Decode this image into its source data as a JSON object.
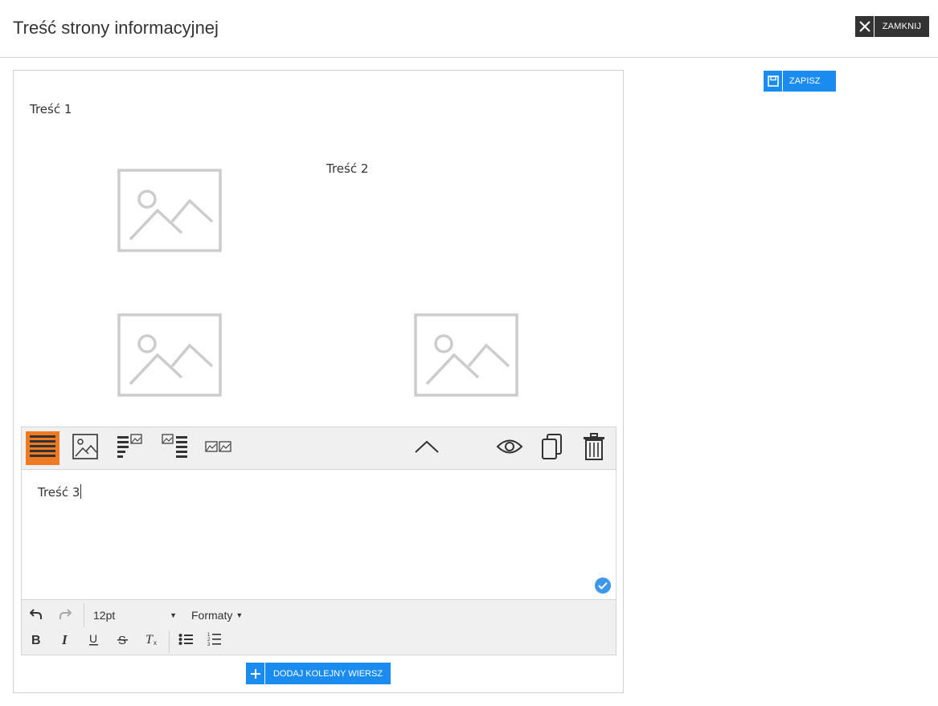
{
  "header": {
    "title": "Treść strony informacyjnej",
    "close_label": "ZAMKNIJ",
    "close_icon": "close-icon"
  },
  "actions": {
    "save_label": "ZAPISZ",
    "save_icon": "floppy-disk-icon"
  },
  "content": {
    "block1_text": "Treść 1",
    "block2_text": "Treść 2",
    "image_placeholder_icon": "image-placeholder-icon"
  },
  "block_toolbar": {
    "layouts": [
      "text-layout-icon",
      "image-layout-icon",
      "text-image-layout-icon",
      "image-text-layout-icon",
      "two-images-layout-icon"
    ],
    "actions": [
      "chevron-up-icon",
      "eye-icon",
      "copy-icon",
      "trash-icon"
    ],
    "active_color": "#ef7a22"
  },
  "editor": {
    "text": "Treść 3",
    "font_size": "12pt",
    "formats_label": "Formaty"
  },
  "footer": {
    "add_row_label": "DODAJ KOLEJNY WIERSZ",
    "add_icon": "plus-icon"
  },
  "colors": {
    "primary": "#1a8cf0",
    "dark": "#333333",
    "accent": "#ef7a22",
    "placeholder": "#cccccc"
  }
}
